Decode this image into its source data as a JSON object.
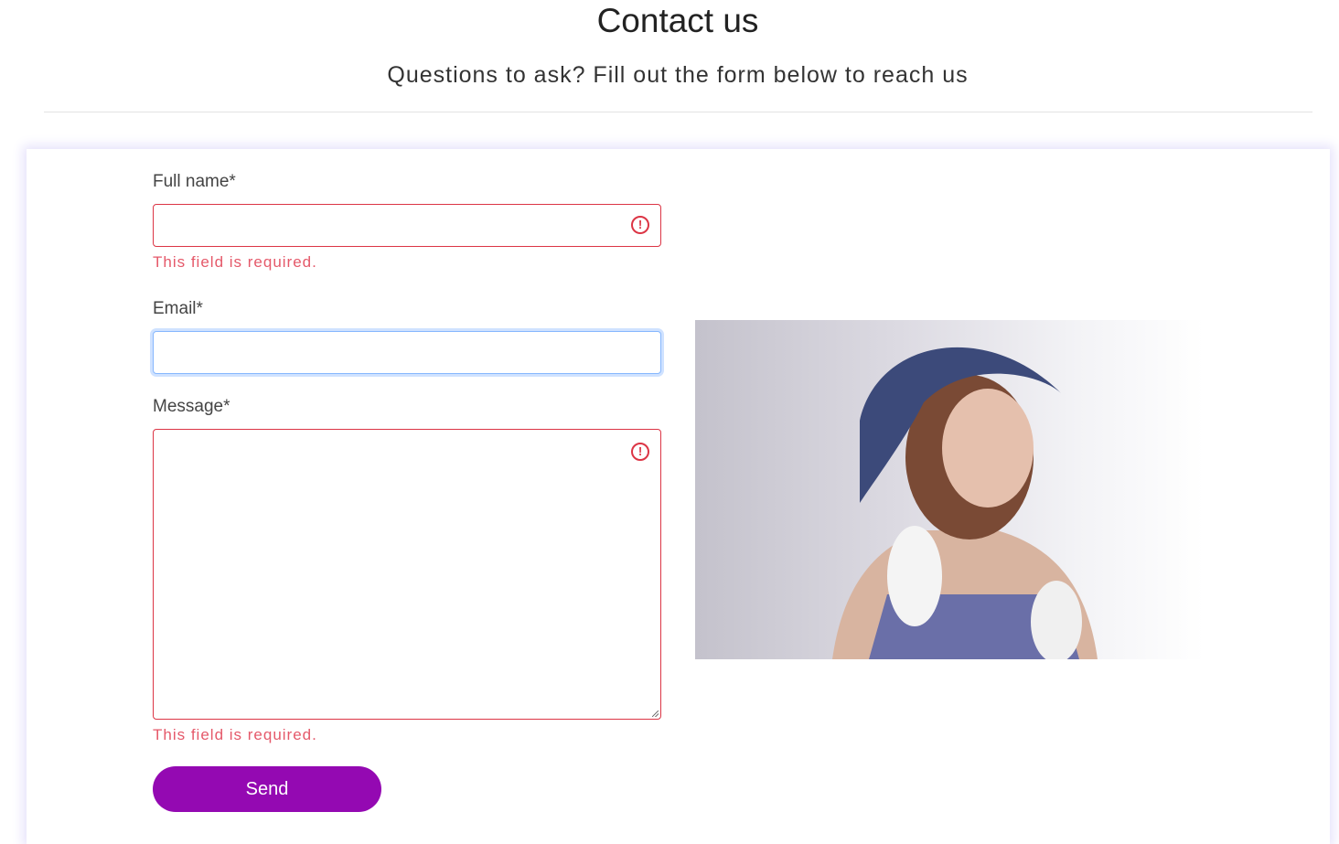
{
  "header": {
    "title": "Contact us",
    "subtitle": "Questions to ask? Fill out the form below to reach us"
  },
  "form": {
    "full_name": {
      "label": "Full name*",
      "value": "",
      "error": "This field is required."
    },
    "email": {
      "label": "Email*",
      "value": ""
    },
    "message": {
      "label": "Message*",
      "value": "",
      "error": "This field is required."
    },
    "send_label": "Send",
    "alert_glyph": "!"
  },
  "colors": {
    "accent": "#9409b2",
    "error": "#dc3545"
  }
}
